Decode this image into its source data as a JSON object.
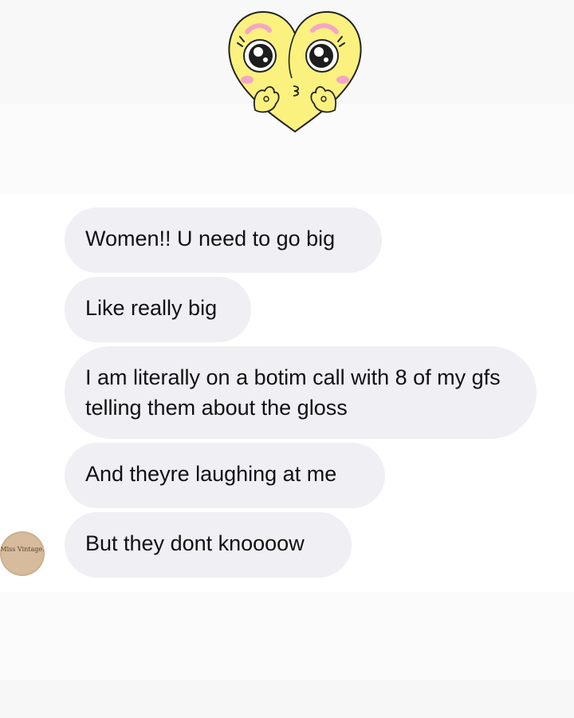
{
  "sticker": {
    "icon": "heart-face-sticker-icon",
    "colors": {
      "face": "#fbf17f",
      "outline": "#222222",
      "cheek": "#f3a6c6"
    }
  },
  "messages": [
    {
      "text": "Women!! U need to go big"
    },
    {
      "text": "Like really big"
    },
    {
      "text": "I am literally on a botim call with 8 of my gfs telling them about the gloss"
    },
    {
      "text": "And theyre laughing at me"
    },
    {
      "text": "But they dont knoooow"
    }
  ],
  "avatar": {
    "icon": "sender-avatar",
    "logo_text": "Miss Vintage."
  },
  "colors": {
    "bubble": "#efeff4",
    "text": "#111111",
    "background": "#ffffff"
  }
}
